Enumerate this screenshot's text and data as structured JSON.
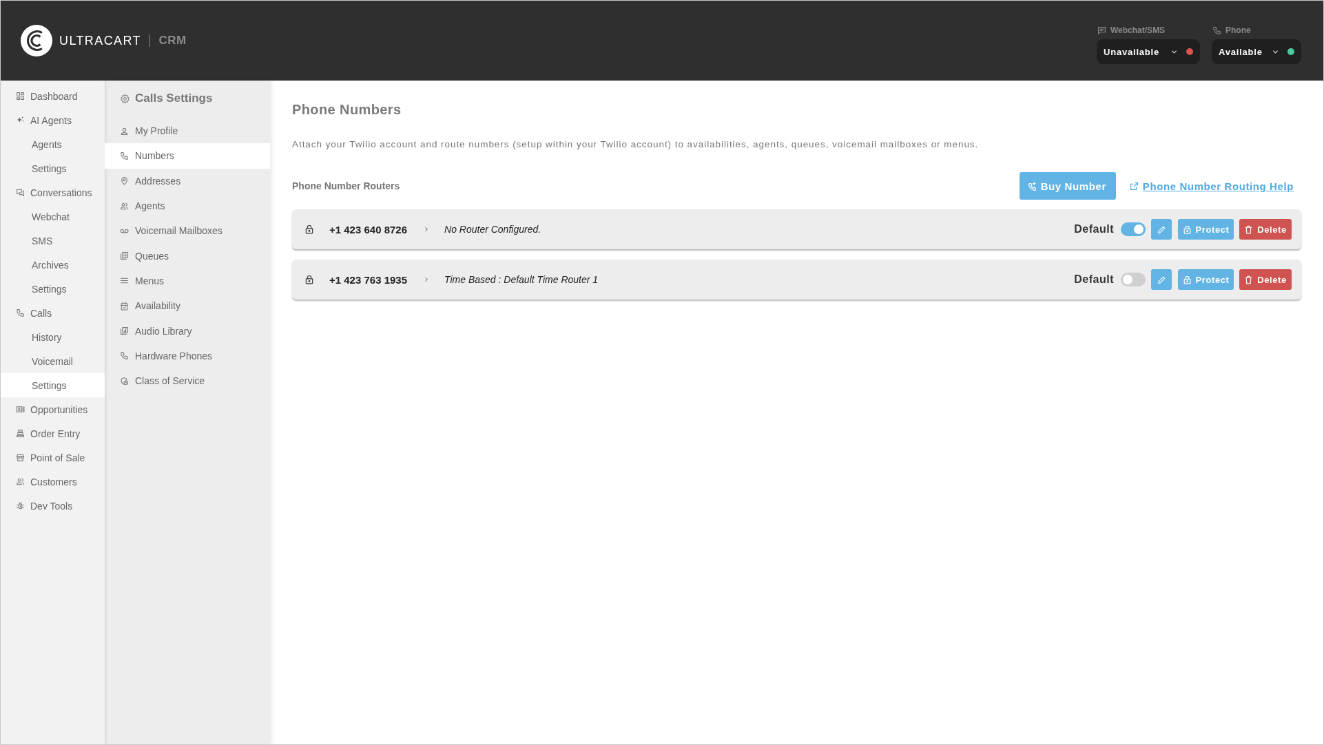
{
  "header": {
    "brand": "ULTRACART",
    "product": "CRM",
    "status_controls": [
      {
        "label": "Webchat/SMS",
        "value": "Unavailable",
        "color": "#d9534f"
      },
      {
        "label": "Phone",
        "value": "Available",
        "color": "#4fc99b"
      }
    ]
  },
  "sidebar": {
    "items": [
      {
        "label": "Dashboard",
        "selected": false
      },
      {
        "label": "AI Agents",
        "selected": false,
        "children": [
          {
            "label": "Agents",
            "selected": false
          },
          {
            "label": "Settings",
            "selected": false
          }
        ]
      },
      {
        "label": "Conversations",
        "selected": false,
        "children": [
          {
            "label": "Webchat",
            "selected": false
          },
          {
            "label": "SMS",
            "selected": false
          },
          {
            "label": "Archives",
            "selected": false
          },
          {
            "label": "Settings",
            "selected": false
          }
        ]
      },
      {
        "label": "Calls",
        "selected": false,
        "children": [
          {
            "label": "History",
            "selected": false
          },
          {
            "label": "Voicemail",
            "selected": false
          },
          {
            "label": "Settings",
            "selected": true
          }
        ]
      },
      {
        "label": "Opportunities",
        "selected": false
      },
      {
        "label": "Order Entry",
        "selected": false
      },
      {
        "label": "Point of Sale",
        "selected": false
      },
      {
        "label": "Customers",
        "selected": false
      },
      {
        "label": "Dev Tools",
        "selected": false
      }
    ]
  },
  "settings_panel": {
    "title": "Calls Settings",
    "items": [
      {
        "label": "My Profile",
        "selected": false
      },
      {
        "label": "Numbers",
        "selected": true
      },
      {
        "label": "Addresses",
        "selected": false
      },
      {
        "label": "Agents",
        "selected": false
      },
      {
        "label": "Voicemail Mailboxes",
        "selected": false
      },
      {
        "label": "Queues",
        "selected": false
      },
      {
        "label": "Menus",
        "selected": false
      },
      {
        "label": "Availability",
        "selected": false
      },
      {
        "label": "Audio Library",
        "selected": false
      },
      {
        "label": "Hardware Phones",
        "selected": false
      },
      {
        "label": "Class of Service",
        "selected": false
      }
    ]
  },
  "main": {
    "title": "Phone Numbers",
    "description": "Attach your Twilio account and route numbers (setup within your Twilio account) to availabilities, agents, queues, voicemail mailboxes or menus.",
    "section_title": "Phone Number Routers",
    "buy_button": "Buy Number",
    "help_link": "Phone Number Routing Help",
    "routers": [
      {
        "number": "+1 423 640 8726",
        "router": "No Router Configured.",
        "default_label": "Default",
        "is_default": true,
        "protect_label": "Protect",
        "delete_label": "Delete"
      },
      {
        "number": "+1 423 763 1935",
        "router": "Time Based : Default Time Router 1",
        "default_label": "Default",
        "is_default": false,
        "protect_label": "Protect",
        "delete_label": "Delete"
      }
    ]
  }
}
